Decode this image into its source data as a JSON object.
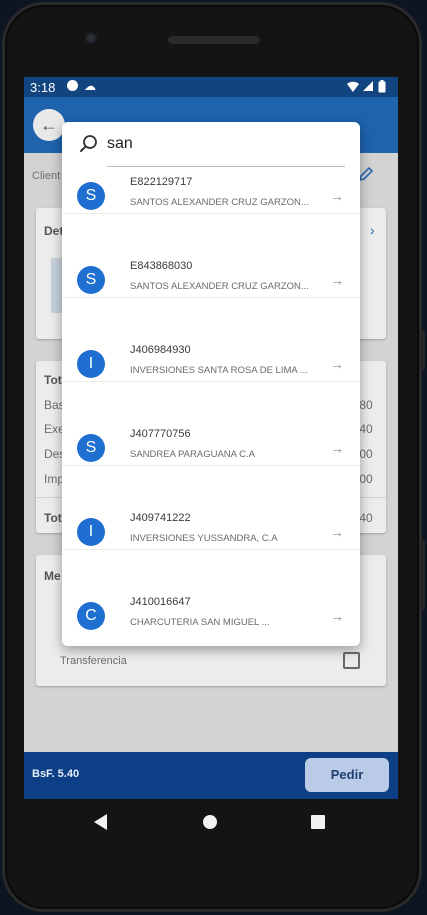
{
  "status_bar": {
    "time": "3:18"
  },
  "background": {
    "cliente_label": "Client",
    "detalle_label": "Det",
    "totales_label": "Tot",
    "rows": [
      "Bas",
      "Exe",
      "Des",
      "Imp"
    ],
    "row_values": [
      ".80",
      ".40",
      ".00",
      ".00"
    ],
    "total_label": "Tot",
    "total_value": ".40",
    "metodo_label": "Me",
    "transferencia_label": "Transferencia"
  },
  "bottom_bar": {
    "total": "BsF. 5.40",
    "pedir_label": "Pedir"
  },
  "dialog": {
    "search_value": "san",
    "results": [
      {
        "avatar": "S",
        "id": "E822129717",
        "name": "SANTOS ALEXANDER CRUZ GARZON..."
      },
      {
        "avatar": "S",
        "id": "E843868030",
        "name": "SANTOS ALEXANDER CRUZ GARZON..."
      },
      {
        "avatar": "I",
        "id": "J406984930",
        "name": "INVERSIONES SANTA ROSA DE LIMA ..."
      },
      {
        "avatar": "S",
        "id": "J407770756",
        "name": "SANDREA PARAGUANA C.A"
      },
      {
        "avatar": "I",
        "id": "J409741222",
        "name": "INVERSIONES YUSSANDRA, C.A"
      },
      {
        "avatar": "C",
        "id": "J410016647",
        "name": "CHARCUTERIA SAN MIGUEL ..."
      }
    ]
  },
  "colors": {
    "accent": "#1e6fcf",
    "app_bar": "#1f63ad",
    "bottom_bar": "#0c3f86"
  }
}
